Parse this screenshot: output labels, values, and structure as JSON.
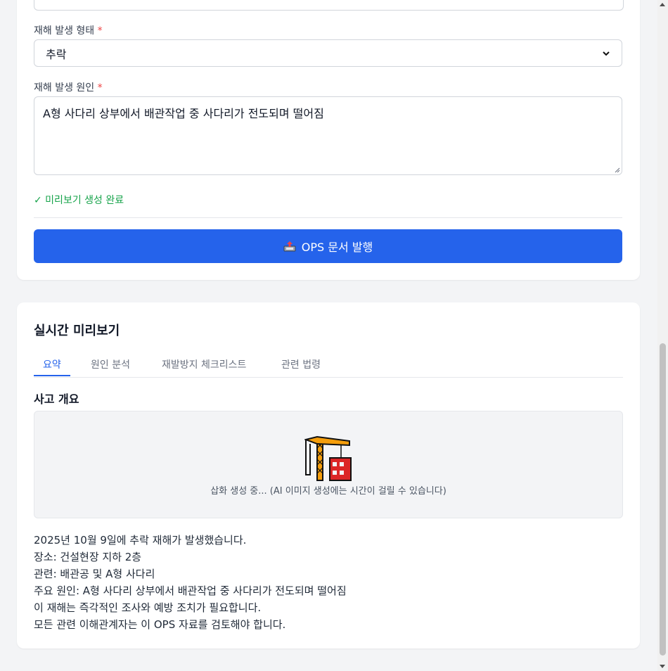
{
  "form": {
    "disaster_type_label": "재해 발생 형태",
    "disaster_type_value": "추락",
    "disaster_cause_label": "재해 발생 원인",
    "disaster_cause_value": "A형 사다리 상부에서 배관작업 중 사다리가 전도되며 떨어짐",
    "required_mark": "*",
    "preview_status": "✓ 미리보기 생성 완료",
    "publish_button": "OPS 문서 발행"
  },
  "preview": {
    "title": "실시간 미리보기",
    "tabs": [
      "요약",
      "원인 분석",
      "재발방지 체크리스트",
      "관련 법령"
    ],
    "active_tab": 0,
    "section_title": "사고 개요",
    "image_caption": "삽화 생성 중... (AI 이미지 생성에는 시간이 걸릴 수 있습니다)",
    "summary_lines": [
      "2025년 10월 9일에 추락 재해가 발생했습니다.",
      "장소: 건설현장 지하 2층",
      "관련: 배관공 및 A형 사다리",
      "주요 원인: A형 사다리 상부에서 배관작업 중 사다리가 전도되며 떨어짐",
      "이 재해는 즉각적인 조사와 예방 조치가 필요합니다.",
      "모든 관련 이해관계자는 이 OPS 자료를 검토해야 합니다."
    ]
  },
  "icons": {
    "publish": "outbox-tray-icon",
    "illustration": "construction-crane-icon"
  },
  "colors": {
    "primary": "#2563eb",
    "success": "#16a34a",
    "required": "#ef4444"
  }
}
